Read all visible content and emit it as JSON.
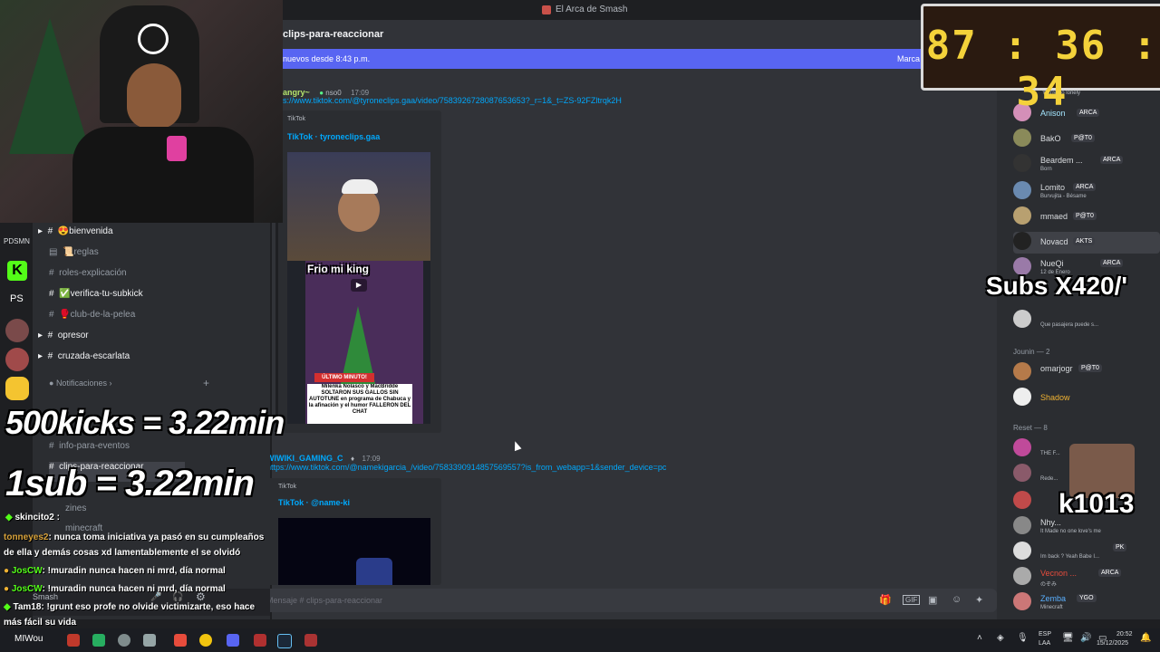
{
  "window": {
    "title": "El Arca de Smash"
  },
  "channel_header": {
    "name": "clips-para-reaccionar"
  },
  "new_messages_bar": {
    "left": "nuevos desde 8:43 p.m.",
    "right": "Marca"
  },
  "messages": [
    {
      "author": "angry~",
      "tag": "nso0",
      "time": "17:09",
      "link": "s://www.tiktok.com/@tyroneclips.gaa/video/7583926728087653653?_r=1&_t=ZS-92FZltrqk2H",
      "embed_provider": "TikTok",
      "embed_title": "TikTok · tyroneclips.gaa",
      "thumb_caption": "Frio mi king",
      "thumb_banner": "ÚLTIMO MINUTO!",
      "thumb_text": "Milenka Nolasco y MacBridde SOLTARON SUS GALLOS SIN AUTOTUNE en programa de Chabuca y la afinación y el humor FALLERON DEL CHAT"
    },
    {
      "author": "WIWIKI_GAMING_C",
      "time": "17:09",
      "link": "https://www.tiktok.com/@namekigarcia_/video/7583390914857569557?is_from_webapp=1&sender_device=pc",
      "embed_provider": "TikTok",
      "embed_title": "TikTok · @name-ki"
    }
  ],
  "input": {
    "placeholder": "Mensaje # clips-para-reaccionar"
  },
  "channels": [
    {
      "label": "bienvenida",
      "emoji": "😍"
    },
    {
      "label": "reglas",
      "emoji": "📜"
    },
    {
      "label": "roles-explicación",
      "emoji": ""
    },
    {
      "label": "verifica-tu-subkick",
      "emoji": "✅"
    },
    {
      "label": "club-de-la-pelea",
      "emoji": "🥊"
    },
    {
      "label": "opresor",
      "emoji": ""
    },
    {
      "label": "cruzada-escarlata",
      "emoji": ""
    }
  ],
  "category": {
    "label": "Notificaciones"
  },
  "channels_lower": [
    {
      "label": "info-para-eventos"
    },
    {
      "label": "clips-para-reaccionar"
    },
    {
      "label": "zines"
    },
    {
      "label": "minecraft"
    }
  ],
  "guilds": {
    "first": "PDSMN",
    "ps": "PS"
  },
  "members": {
    "top_status": "You're so lonely",
    "list": [
      {
        "name": "Anison",
        "badge": "ARCA",
        "sub": ""
      },
      {
        "name": "BakO",
        "badge": "P@T0",
        "sub": ""
      },
      {
        "name": "Beardem ...",
        "badge": "ARCA",
        "sub": "Born"
      },
      {
        "name": "Lomito",
        "badge": "ARCA",
        "sub": "Burvujita - Bésame"
      },
      {
        "name": "mmaed",
        "badge": "P@T0",
        "sub": ""
      },
      {
        "name": "Novacd",
        "badge": "AKTS",
        "sub": ""
      },
      {
        "name": "NueQi",
        "badge": "ARCA",
        "sub": "12 de Enero"
      },
      {
        "name": "...",
        "badge": "",
        "sub": "Que pasajera puede s..."
      }
    ],
    "section_jounin": "Jounin — 2",
    "jounin": [
      {
        "name": "omarjogr",
        "badge": "P@T0",
        "sub": ""
      },
      {
        "name": "Shadow",
        "badge": "",
        "sub": ""
      }
    ],
    "section_reset": "Reset — 8",
    "reset": [
      {
        "name": "",
        "sub": "THE F..."
      },
      {
        "name": "",
        "sub": "Rede..."
      },
      {
        "name": "",
        "sub": ""
      },
      {
        "name": "Nhy...",
        "sub": "It Made no one love's me"
      },
      {
        "name": "",
        "badge": "PK",
        "sub": "Im back ? Yeah Babe I..."
      },
      {
        "name": "Vecnon ...",
        "badge": "ARCA",
        "sub": "のぞみ"
      },
      {
        "name": "Zemba",
        "badge": "YGO",
        "sub": "Minecraft"
      }
    ]
  },
  "overlays": {
    "timer": "87 : 36 : 34",
    "subs": "Subs X420/'",
    "kicks_line": "500kicks = 3.22min",
    "sub_line": "1sub = 3.22min",
    "k_counter": "k1013"
  },
  "stream_chat": [
    {
      "user": "skincito2",
      "text": ""
    },
    {
      "user": "tonneyes2",
      "text": ": nunca toma iniciativa ya pasó en su cumpleaños"
    },
    {
      "user": "",
      "text": "de ella y demás cosas xd lamentablemente el se olvidó"
    },
    {
      "user": "JosCW",
      "text": ": !muradin nunca hacen ni mrd, día normal"
    },
    {
      "user": "JosCW",
      "text": ": !muradin nunca hacen ni mrd, día normal"
    },
    {
      "user": "Tam18",
      "text": ": !grunt eso profe no olvide victimizarte, eso hace"
    },
    {
      "user": "",
      "text": "más fácil su vida"
    }
  ],
  "user_panel": {
    "name": "Smash"
  },
  "taskbar": {
    "lang": "ESP",
    "layout": "LAA",
    "time": "20:52",
    "date": "15/12/2025",
    "bottom_name": "MIWou"
  },
  "colors": {
    "blurple": "#5865f2",
    "link": "#00a8fc",
    "timer": "#f4d23a"
  }
}
